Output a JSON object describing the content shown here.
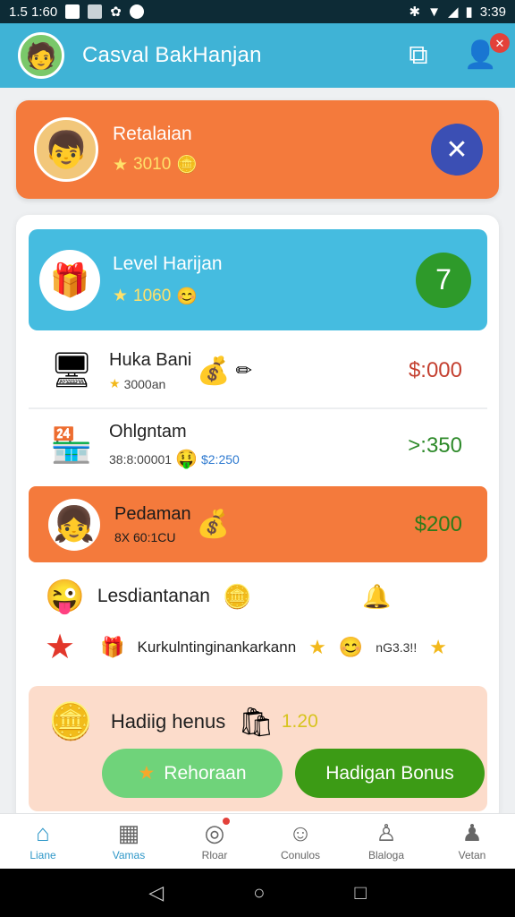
{
  "statusbar": {
    "left_text": "1.5 1:60",
    "time": "3:39"
  },
  "app": {
    "title": "Casval BakHanjan"
  },
  "profile": {
    "name": "Retalaian",
    "score": "3010"
  },
  "level": {
    "title": "Level Harijan",
    "score": "1060",
    "badge": "7"
  },
  "rows": [
    {
      "name": "Huka Bani",
      "sub": "3000an",
      "value": "$:000"
    },
    {
      "name": "Ohlgntam",
      "sub": "38:8:00001",
      "sub2": "$2:250",
      "value": ">:350"
    },
    {
      "name": "Pedaman",
      "sub": "8X 60:1CU",
      "value": "$200"
    }
  ],
  "list": [
    {
      "text": "Lesdiantanan"
    },
    {
      "text": "Kurkulntinginankarkann",
      "tail": "nG3.3!!"
    }
  ],
  "bonus": {
    "label": "Hadiig henus",
    "value": "1.20",
    "btn_secondary": "Rehoraan",
    "btn_primary": "Hadigan Bonus"
  },
  "nav": [
    {
      "label": "Liane",
      "icon": "home-icon"
    },
    {
      "label": "Vamas",
      "icon": "calendar-icon"
    },
    {
      "label": "Rloar",
      "icon": "dial-icon"
    },
    {
      "label": "Conulos",
      "icon": "person-icon"
    },
    {
      "label": "Blaloga",
      "icon": "group-icon"
    },
    {
      "label": "Vetan",
      "icon": "user-icon"
    }
  ],
  "colors": {
    "appbar": "#3fb3d6",
    "orange": "#f47a3c",
    "green": "#2e9a2a",
    "red_value": "#c44030",
    "green_value": "#2e8a2a"
  }
}
